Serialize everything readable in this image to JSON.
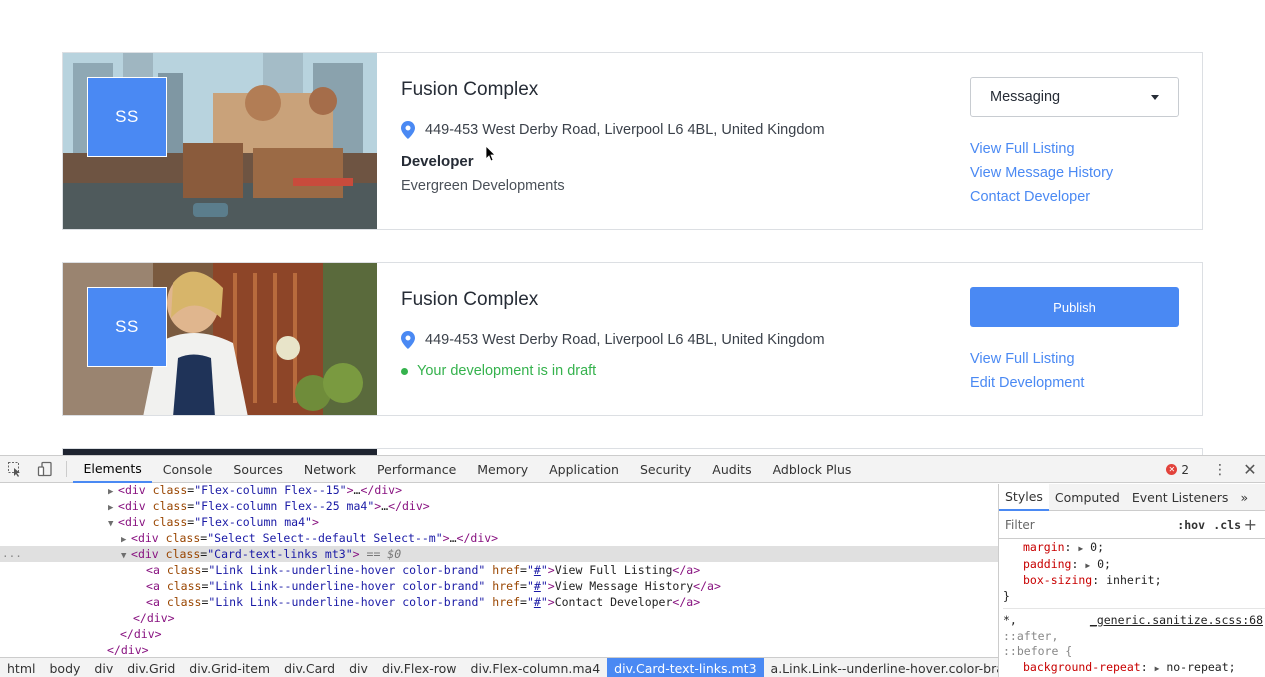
{
  "cards": [
    {
      "avatar": "SS",
      "title": "Fusion Complex",
      "address": "449-453 West Derby Road, Liverpool L6 4BL, United Kingdom",
      "developer_label": "Developer",
      "developer_name": "Evergreen Developments",
      "select_value": "Messaging",
      "links": [
        "View Full Listing",
        "View Message History",
        "Contact Developer"
      ]
    },
    {
      "avatar": "SS",
      "title": "Fusion Complex",
      "address": "449-453 West Derby Road, Liverpool L6 4BL, United Kingdom",
      "status": "Your development is in draft",
      "button_label": "Publish",
      "links": [
        "View Full Listing",
        "Edit Development"
      ]
    }
  ],
  "devtools": {
    "tabs": [
      "Elements",
      "Console",
      "Sources",
      "Network",
      "Performance",
      "Memory",
      "Application",
      "Security",
      "Audits",
      "Adblock Plus"
    ],
    "active_tab": "Elements",
    "error_count": "2",
    "dom": {
      "l1_class": "Flex-column Flex--15",
      "l2_class": "Flex-column Flex--25 ma4",
      "l3_class": "Flex-column ma4",
      "l4_class": "Select Select--default Select--m",
      "l5_class": "Card-text-links mt3",
      "l5_marker": "== $0",
      "link_class": "Link Link--underline-hover color-brand",
      "link_href": "#",
      "link_texts": [
        "View Full Listing",
        "View Message History",
        "Contact Developer"
      ],
      "tag_div": "div",
      "tag_a": "a",
      "attr_class": "class",
      "attr_href": "href",
      "ellipsis": "…",
      "row_dots": "..."
    },
    "breadcrumb": [
      "html",
      "body",
      "div",
      "div.Grid",
      "div.Grid-item",
      "div.Card",
      "div",
      "div.Flex-row",
      "div.Flex-column.ma4",
      "div.Card-text-links.mt3",
      "a.Link.Link--underline-hover.color-brand"
    ],
    "breadcrumb_active": "div.Card-text-links.mt3",
    "styles": {
      "tabs": [
        "Styles",
        "Computed",
        "Event Listeners"
      ],
      "more_tabs": "»",
      "filter_placeholder": "Filter",
      "hov": ":hov",
      "cls": ".cls",
      "plus": "+",
      "rules": [
        {
          "prop": "margin",
          "val": "0;"
        },
        {
          "prop": "padding",
          "val": "0;"
        },
        {
          "prop": "box-sizing",
          "val": "inherit;"
        }
      ],
      "close_brace": "}",
      "selector2": "*,",
      "selector2b": "::after,",
      "selector2c": "::before {",
      "source": "_generic.sanitize.scss:68",
      "rule2": {
        "prop": "background-repeat",
        "val": "no-repeat;"
      }
    }
  }
}
